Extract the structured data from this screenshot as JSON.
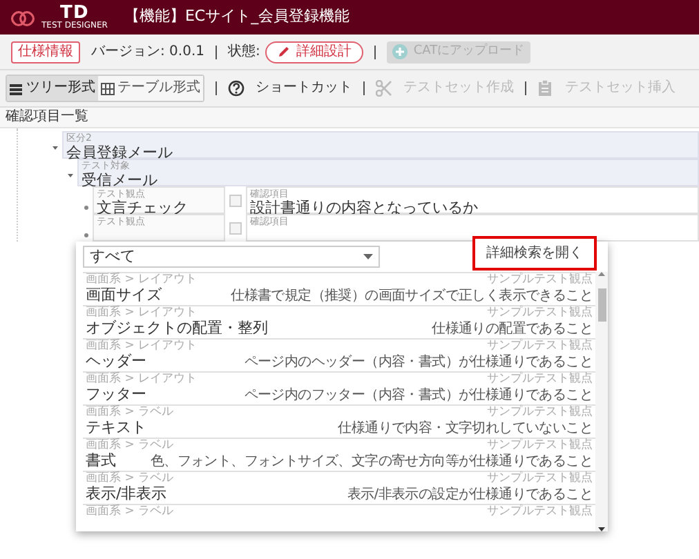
{
  "header": {
    "logo": "TD",
    "logo_subtitle": "TEST DESIGNER",
    "title": "【機能】ECサイト_会員登録機能"
  },
  "toolbar": {
    "spec_button": "仕様情報",
    "version": "バージョン: 0.0.1",
    "status_label": "状態:",
    "status": "詳細設計",
    "upload_button": {
      "label": "CATにアップロード",
      "disabled": true
    }
  },
  "view_toolbar": {
    "views": [
      {
        "label": "ツリー形式",
        "kind": "tree",
        "selected": true
      },
      {
        "label": "テーブル形式",
        "kind": "table",
        "selected": false
      }
    ],
    "actions": [
      {
        "label": "ショートカット",
        "kind": "help",
        "disabled": false
      },
      {
        "label": "テストセット作成",
        "kind": "cut",
        "disabled": true
      },
      {
        "label": "テストセット挿入",
        "kind": "paste",
        "disabled": true
      }
    ]
  },
  "section_title": "確認項目一覧",
  "tree": [
    {
      "field": "区分2",
      "text": "会員登録メール",
      "expanded": true,
      "children": [
        {
          "field": "テスト対象",
          "text": "受信メール",
          "expanded": true,
          "children": [
            {
              "kind": "viewpoint",
              "field": "テスト観点",
              "text": "文言チェック",
              "check_field": "確認項目",
              "check_text": "設計書通りの内容となっているか"
            },
            {
              "kind": "viewpoint",
              "field": "テスト観点",
              "check_field": "確認項目"
            }
          ]
        }
      ]
    }
  ],
  "popup": {
    "filter": {
      "value": "すべて"
    },
    "open_search_link": "詳細検索を開く",
    "items": [
      {
        "category": "画面系 > レイアウト",
        "source": "サンプルテスト観点",
        "title": "画面サイズ",
        "description": "仕様書で規定（推奨）の画面サイズで正しく表示できること"
      },
      {
        "category": "画面系 > レイアウト",
        "source": "サンプルテスト観点",
        "title": "オブジェクトの配置・整列",
        "description": "仕様通りの配置であること"
      },
      {
        "category": "画面系 > レイアウト",
        "source": "サンプルテスト観点",
        "title": "ヘッダー",
        "description": "ページ内のヘッダー（内容・書式）が仕様通りであること"
      },
      {
        "category": "画面系 > レイアウト",
        "source": "サンプルテスト観点",
        "title": "フッター",
        "description": "ページ内のフッター（内容・書式）が仕様通りであること"
      },
      {
        "category": "画面系 > ラベル",
        "source": "サンプルテスト観点",
        "title": "テキスト",
        "description": "仕様通りで内容・文字切れしていないこと"
      },
      {
        "category": "画面系 > ラベル",
        "source": "サンプルテスト観点",
        "title": "書式",
        "description": "色、フォント、フォントサイズ、文字の寄せ方向等が仕様通りであること"
      },
      {
        "category": "画面系 > ラベル",
        "source": "サンプルテスト観点",
        "title": "表示/非表示",
        "description": "表示/非表示の設定が仕様通りであること"
      },
      {
        "category": "画面系 > ラベル",
        "source": "サンプルテスト観点"
      }
    ]
  }
}
